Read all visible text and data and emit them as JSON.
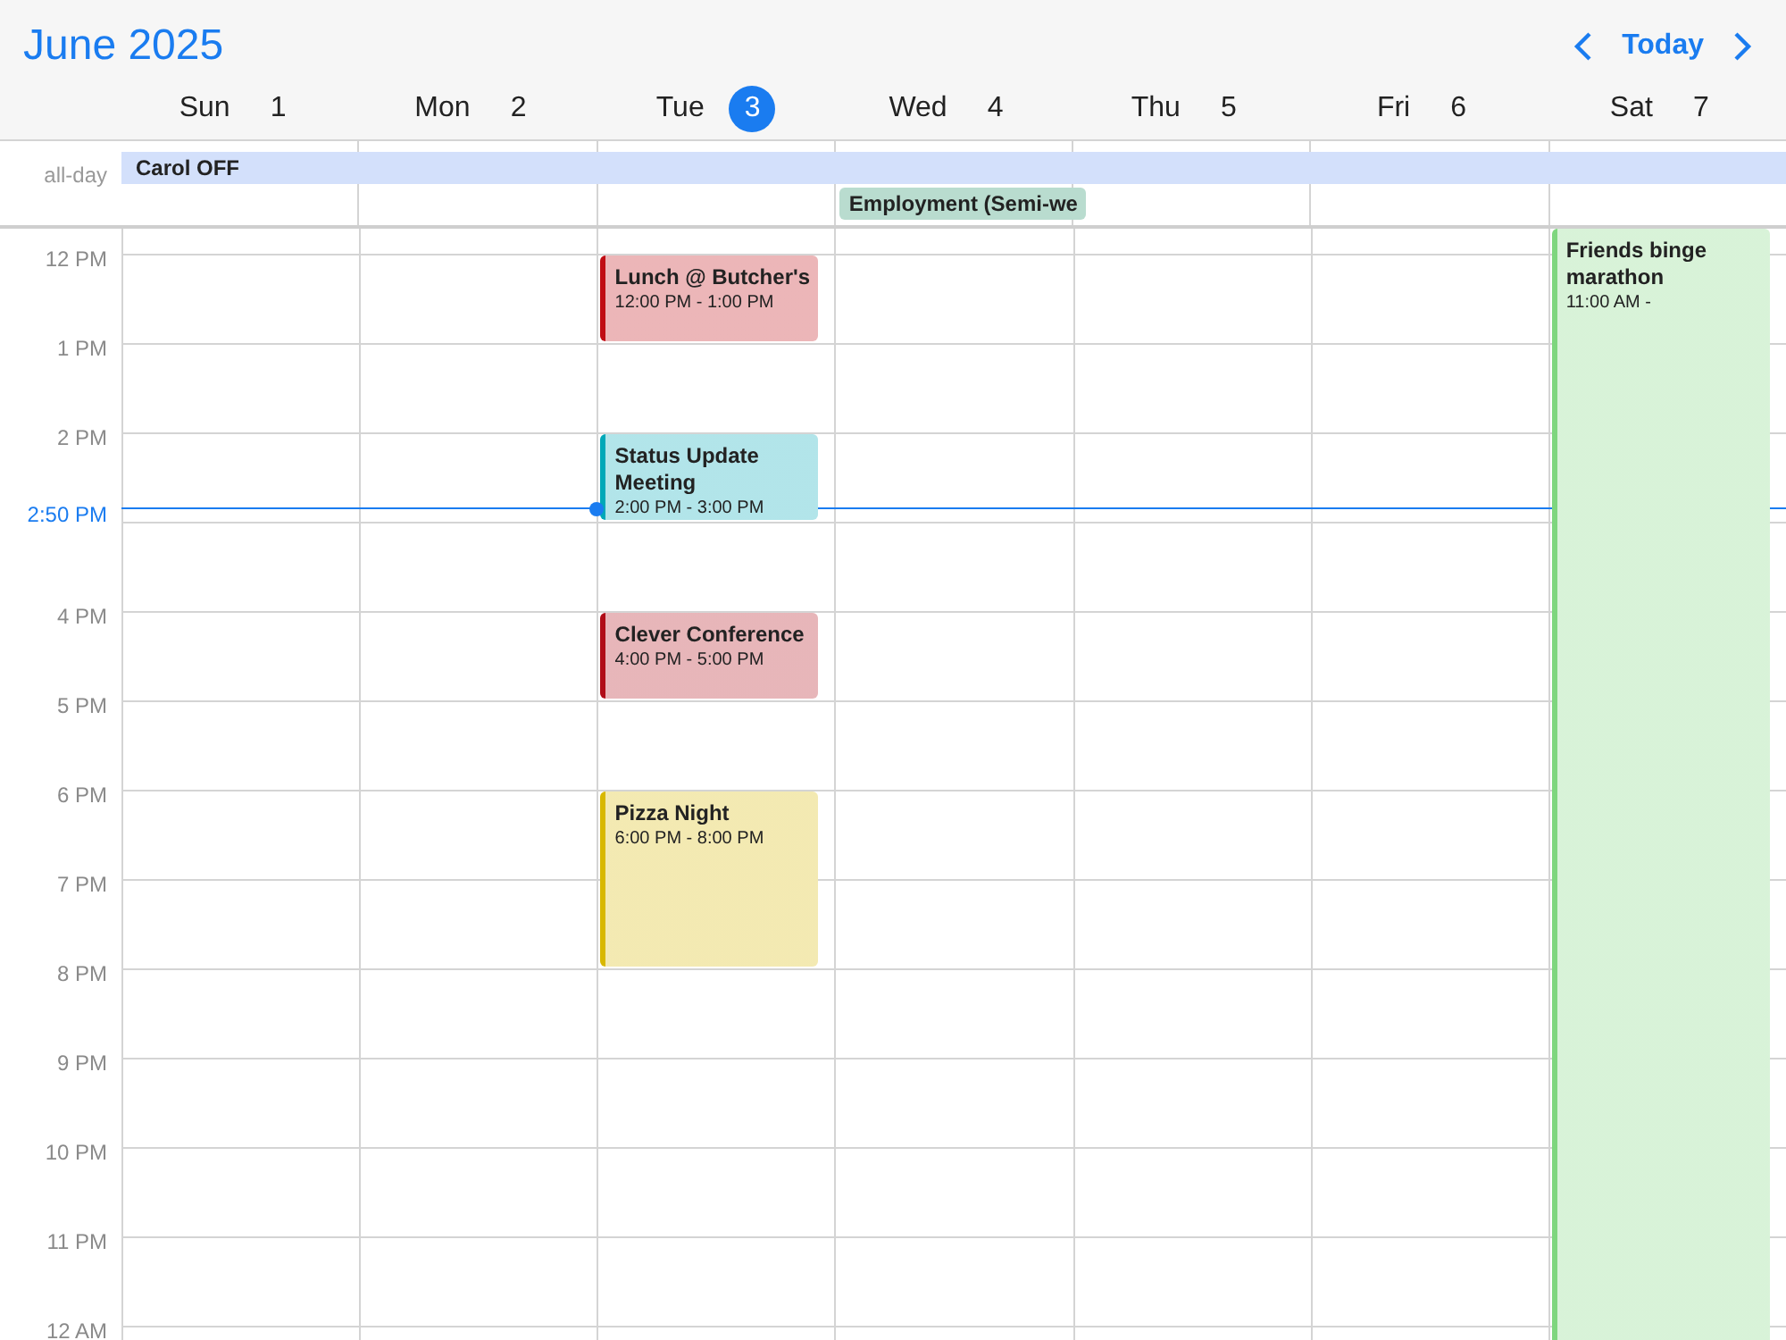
{
  "header": {
    "title": "June 2025",
    "today_button": "Today"
  },
  "days": [
    {
      "weekday": "Sun",
      "date": "1",
      "today": false
    },
    {
      "weekday": "Mon",
      "date": "2",
      "today": false
    },
    {
      "weekday": "Tue",
      "date": "3",
      "today": true,
      "events": [
        {
          "title": "Lunch @ Butcher's",
          "time": "12:00 PM - 1:00 PM",
          "color": "#c00d14"
        },
        {
          "title": "Status Update Meeting",
          "time": "2:00 PM - 3:00 PM",
          "color": "#00a8b8"
        },
        {
          "title": "Clever Conference",
          "time": "4:00 PM - 5:00 PM",
          "color": "#b00d18"
        },
        {
          "title": "Pizza Night",
          "time": "6:00 PM - 8:00 PM",
          "color": "#d8b800"
        }
      ]
    },
    {
      "weekday": "Wed",
      "date": "4",
      "today": false
    },
    {
      "weekday": "Thu",
      "date": "5",
      "today": false
    },
    {
      "weekday": "Fri",
      "date": "6",
      "today": false
    },
    {
      "weekday": "Sat",
      "date": "7",
      "today": false,
      "events": [
        {
          "title": "Friends binge marathon",
          "time": "11:00 AM -",
          "color": "#7ed67e"
        }
      ]
    }
  ],
  "all_day": {
    "label": "all-day",
    "events": [
      {
        "title": "Carol OFF",
        "color": "#d3e0fb"
      },
      {
        "title": "Employment (Semi-we",
        "color": "#b9dccf"
      }
    ]
  },
  "hour_rows": [
    {
      "label": "12 PM"
    },
    {
      "label": "1 PM"
    },
    {
      "label": "2 PM"
    },
    {},
    {
      "label": "4 PM"
    },
    {
      "label": "5 PM"
    },
    {
      "label": "6 PM"
    },
    {
      "label": "7 PM"
    },
    {
      "label": "8 PM"
    },
    {
      "label": "9 PM"
    },
    {
      "label": "10 PM"
    },
    {
      "label": "11 PM"
    },
    {
      "label": "12 AM"
    }
  ],
  "now_indicator": {
    "label": "2:50 PM"
  }
}
